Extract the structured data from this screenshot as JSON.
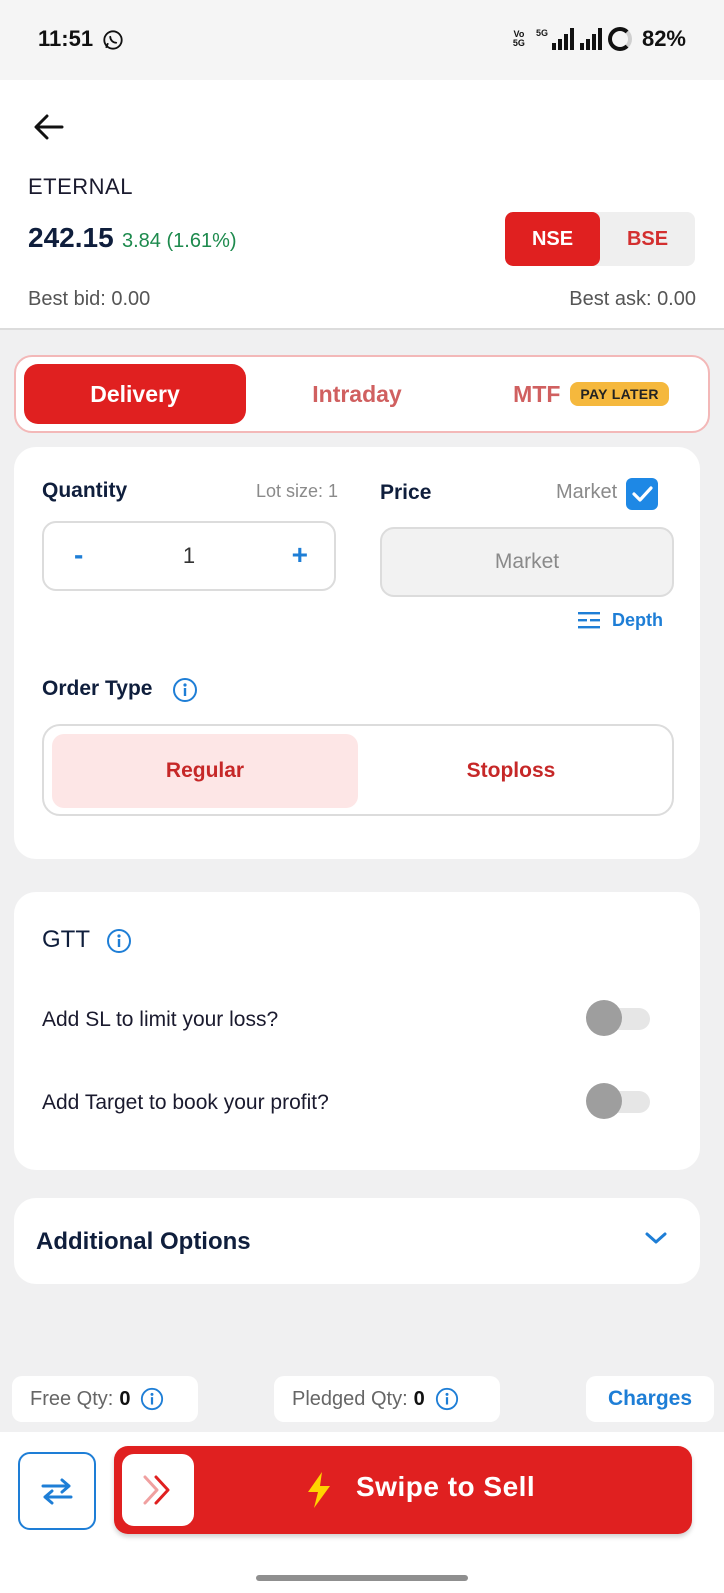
{
  "status_bar": {
    "time": "11:51",
    "network_tag": "Vo 5G",
    "network_gen": "5G",
    "battery": "82%"
  },
  "header": {
    "symbol": "ETERNAL",
    "ltp": "242.15",
    "change": "3.84 (1.61%)",
    "exchanges": [
      "NSE",
      "BSE"
    ],
    "selected_exchange": "NSE",
    "best_bid": "Best bid: 0.00",
    "best_ask": "Best ask: 0.00"
  },
  "product_tabs": {
    "items": [
      "Delivery",
      "Intraday",
      "MTF"
    ],
    "selected": "Delivery",
    "mtf_badge": "PAY LATER"
  },
  "order": {
    "quantity_label": "Quantity",
    "lot_size": "Lot size: 1",
    "minus": "-",
    "quantity_value": "1",
    "plus": "+",
    "price_label": "Price",
    "market_toggle_label": "Market",
    "market_checked": true,
    "price_value": "Market",
    "depth_label": "Depth",
    "order_type_label": "Order Type",
    "order_types": [
      "Regular",
      "Stoploss"
    ],
    "selected_order_type": "Regular"
  },
  "gtt": {
    "title": "GTT",
    "sl_label": "Add SL to limit your loss?",
    "sl_enabled": false,
    "target_label": "Add Target to book your profit?",
    "target_enabled": false
  },
  "additional_options": {
    "label": "Additional Options"
  },
  "footer": {
    "free_qty_label": "Free Qty:",
    "free_qty_value": "0",
    "pledged_qty_label": "Pledged Qty:",
    "pledged_qty_value": "0",
    "charges_label": "Charges",
    "swipe_label": "Swipe to Sell"
  },
  "colors": {
    "accent_red": "#e02020",
    "link_blue": "#1e7ed6",
    "gain_green": "#1d8a4d",
    "badge_yellow": "#f5b83d"
  },
  "icons": [
    "whatsapp-icon",
    "back-arrow-icon",
    "checkbox-icon",
    "depth-icon",
    "info-icon",
    "chevron-down-icon",
    "swap-icon",
    "double-chevron-right-icon",
    "lightning-icon"
  ]
}
